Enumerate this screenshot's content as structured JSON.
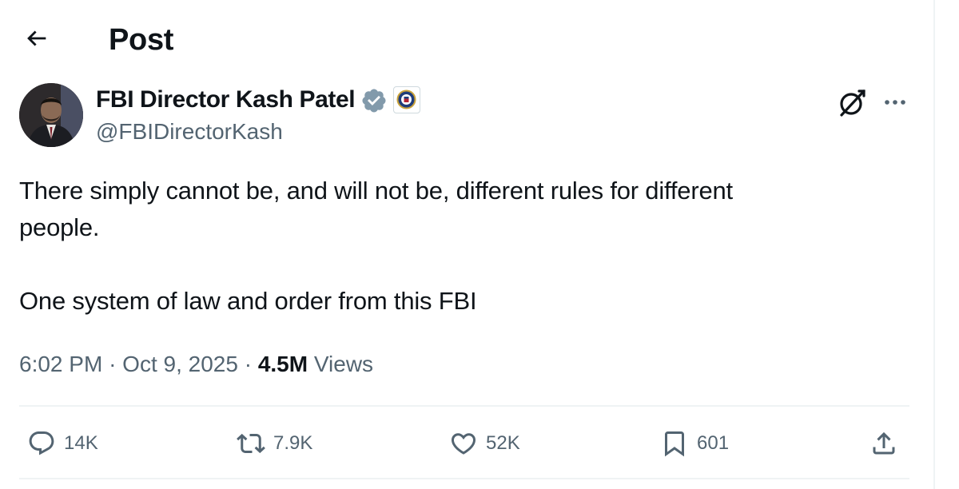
{
  "header": {
    "title": "Post",
    "back_icon": "arrow-left-icon"
  },
  "author": {
    "name": "FBI Director Kash Patel",
    "handle": "@FBIDirectorKash",
    "verified_icon": "verified-badge-icon",
    "affiliation_icon": "fbi-seal-icon",
    "badge_color": "#829aab"
  },
  "post": {
    "lines": [
      "There simply cannot be, and will not be, different rules for different",
      "people.",
      "One system of law and order from this FBI"
    ],
    "time": "6:02 PM",
    "sep": "·",
    "date": "Oct 9, 2025",
    "views_count": "4.5M",
    "views_label": "Views"
  },
  "actions": {
    "replies": "14K",
    "reposts": "7.9K",
    "likes": "52K",
    "bookmarks": "601"
  },
  "colors": {
    "text": "#0f1419",
    "secondary": "#536471",
    "border": "#eff3f4"
  }
}
